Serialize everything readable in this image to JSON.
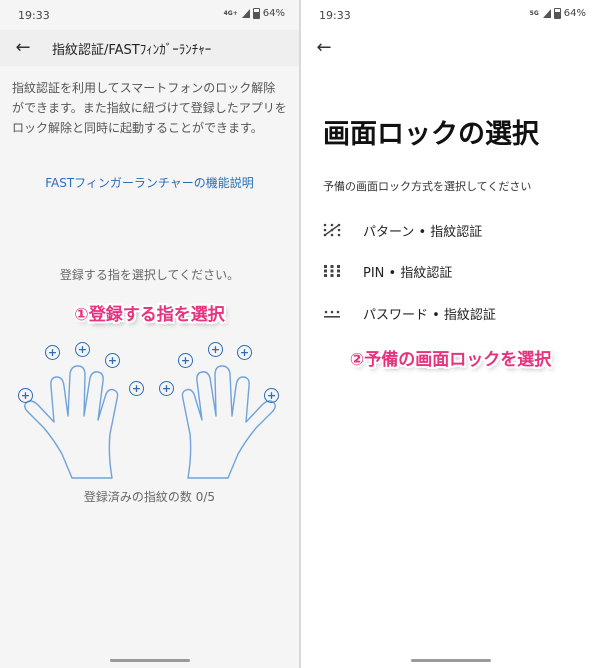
{
  "left": {
    "status": {
      "time": "19:33",
      "network": "4G+",
      "battery": "64%"
    },
    "appbar": {
      "title": "指紋認証/FASTﾌｨﾝｶﾞｰﾗﾝﾁｬｰ",
      "back_icon": "arrow-back-icon"
    },
    "description": "指紋認証を利用してスマートフォンのロック解除ができます。また指紋に紐づけて登録したアプリをロック解除と同時に起動することができます。",
    "link": "FASTフィンガーランチャーの機能説明",
    "prompt": "登録する指を選択してください。",
    "annotation": "①登録する指を選択",
    "fingerprint_count": "登録済みの指紋の数 0/5",
    "accent": "#2a6db8"
  },
  "right": {
    "status": {
      "time": "19:33",
      "network": "5G",
      "battery": "64%"
    },
    "appbar": {
      "back_icon": "arrow-back-icon"
    },
    "title": "画面ロックの選択",
    "subtitle": "予備の画面ロック方式を選択してください",
    "options": [
      {
        "icon": "pattern-icon",
        "label": "パターン • 指紋認証"
      },
      {
        "icon": "pin-icon",
        "label": "PIN • 指紋認証"
      },
      {
        "icon": "password-icon",
        "label": "パスワード • 指紋認証"
      }
    ],
    "annotation": "②予備の画面ロックを選択",
    "annotation_color": "#e8327e"
  }
}
